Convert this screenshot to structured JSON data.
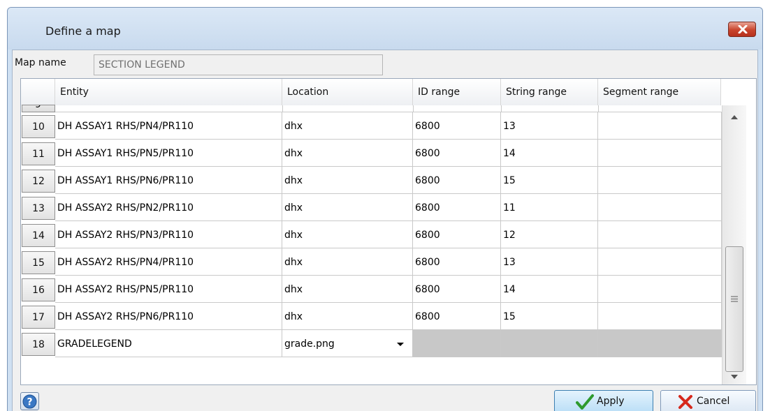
{
  "window": {
    "title": "Define a map"
  },
  "map_name": {
    "label": "Map name",
    "value": "SECTION LEGEND"
  },
  "grid": {
    "columns": [
      "Entity",
      "Location",
      "ID range",
      "String range",
      "Segment range"
    ],
    "partial_row_number": "9",
    "rows": [
      {
        "num": "10",
        "entity": "DH ASSAY1 RHS/PN4/PR110",
        "location": "dhx",
        "id_range": "6800",
        "string_range": "13",
        "segment_range": ""
      },
      {
        "num": "11",
        "entity": "DH ASSAY1 RHS/PN5/PR110",
        "location": "dhx",
        "id_range": "6800",
        "string_range": "14",
        "segment_range": ""
      },
      {
        "num": "12",
        "entity": "DH ASSAY1 RHS/PN6/PR110",
        "location": "dhx",
        "id_range": "6800",
        "string_range": "15",
        "segment_range": ""
      },
      {
        "num": "13",
        "entity": "DH ASSAY2 RHS/PN2/PR110",
        "location": "dhx",
        "id_range": "6800",
        "string_range": "11",
        "segment_range": ""
      },
      {
        "num": "14",
        "entity": "DH ASSAY2 RHS/PN3/PR110",
        "location": "dhx",
        "id_range": "6800",
        "string_range": "12",
        "segment_range": ""
      },
      {
        "num": "15",
        "entity": "DH ASSAY2 RHS/PN4/PR110",
        "location": "dhx",
        "id_range": "6800",
        "string_range": "13",
        "segment_range": ""
      },
      {
        "num": "16",
        "entity": "DH ASSAY2 RHS/PN5/PR110",
        "location": "dhx",
        "id_range": "6800",
        "string_range": "14",
        "segment_range": ""
      },
      {
        "num": "17",
        "entity": "DH ASSAY2 RHS/PN6/PR110",
        "location": "dhx",
        "id_range": "6800",
        "string_range": "15",
        "segment_range": ""
      }
    ],
    "last_row": {
      "num": "18",
      "entity": "GRADELEGEND",
      "location": "grade.png"
    }
  },
  "buttons": {
    "apply": "Apply",
    "cancel": "Cancel"
  },
  "icons": {
    "close": "close-x-icon",
    "help": "help-question-icon",
    "apply": "green-check-icon",
    "cancel": "red-x-icon",
    "dropdown": "dropdown-arrow-icon",
    "scroll_up": "scroll-up-arrow-icon",
    "scroll_down": "scroll-down-arrow-icon",
    "scroll_grip": "scroll-grip-icon"
  },
  "colors": {
    "accent": "#3c7fb1",
    "close": "#c8442c",
    "disabled_cell": "#c8c8c8"
  }
}
